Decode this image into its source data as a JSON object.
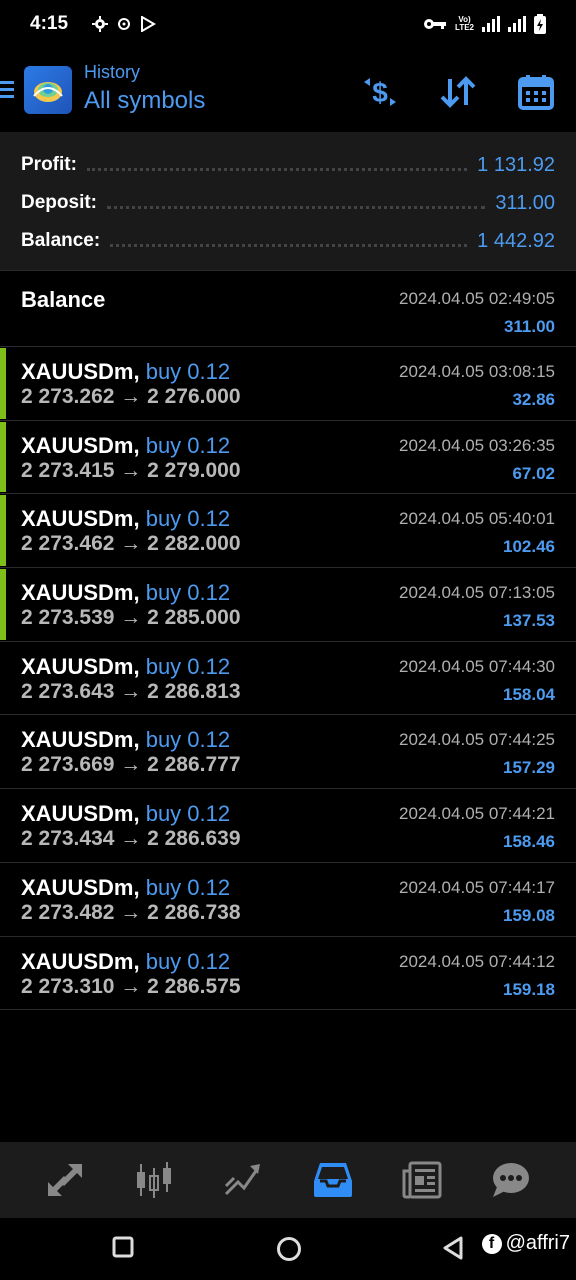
{
  "status_bar": {
    "time": "4:15",
    "volte_top": "Vo)",
    "volte_bottom": "LTE2"
  },
  "header": {
    "subtitle": "History",
    "title": "All symbols",
    "icons": [
      "menu-icon",
      "app-logo",
      "dollar-exchange-icon",
      "sort-icon",
      "calendar-icon"
    ]
  },
  "summary": {
    "profit_label": "Profit:",
    "profit_value": "1 131.92",
    "deposit_label": "Deposit:",
    "deposit_value": "311.00",
    "balance_label": "Balance:",
    "balance_value": "1 442.92"
  },
  "balance_entry": {
    "label": "Balance",
    "time": "2024.04.05 02:49:05",
    "amount": "311.00"
  },
  "deals": [
    {
      "symbol": "XAUUSDm,",
      "type": "buy 0.12",
      "prices": "2 273.262 → 2 276.000",
      "time": "2024.04.05 03:08:15",
      "profit": "32.86",
      "marked": true
    },
    {
      "symbol": "XAUUSDm,",
      "type": "buy 0.12",
      "prices": "2 273.415 → 2 279.000",
      "time": "2024.04.05 03:26:35",
      "profit": "67.02",
      "marked": true
    },
    {
      "symbol": "XAUUSDm,",
      "type": "buy 0.12",
      "prices": "2 273.462 → 2 282.000",
      "time": "2024.04.05 05:40:01",
      "profit": "102.46",
      "marked": true
    },
    {
      "symbol": "XAUUSDm,",
      "type": "buy 0.12",
      "prices": "2 273.539 → 2 285.000",
      "time": "2024.04.05 07:13:05",
      "profit": "137.53",
      "marked": true
    },
    {
      "symbol": "XAUUSDm,",
      "type": "buy 0.12",
      "prices": "2 273.643 → 2 286.813",
      "time": "2024.04.05 07:44:30",
      "profit": "158.04",
      "marked": false
    },
    {
      "symbol": "XAUUSDm,",
      "type": "buy 0.12",
      "prices": "2 273.669 → 2 286.777",
      "time": "2024.04.05 07:44:25",
      "profit": "157.29",
      "marked": false
    },
    {
      "symbol": "XAUUSDm,",
      "type": "buy 0.12",
      "prices": "2 273.434 → 2 286.639",
      "time": "2024.04.05 07:44:21",
      "profit": "158.46",
      "marked": false
    },
    {
      "symbol": "XAUUSDm,",
      "type": "buy 0.12",
      "prices": "2 273.482 → 2 286.738",
      "time": "2024.04.05 07:44:17",
      "profit": "159.08",
      "marked": false
    },
    {
      "symbol": "XAUUSDm,",
      "type": "buy 0.12",
      "prices": "2 273.310 → 2 286.575",
      "time": "2024.04.05 07:44:12",
      "profit": "159.18",
      "marked": false
    }
  ],
  "bottom_nav": {
    "items": [
      "quotes-icon",
      "chart-icon",
      "trade-icon",
      "history-icon",
      "news-icon",
      "chat-icon"
    ],
    "active": "history-icon"
  },
  "watermark": {
    "text": "@affri7"
  },
  "colors": {
    "accent": "#4d9bf0",
    "marker": "#7fbf1a",
    "background": "#000000",
    "summary_bg": "#1a1a1a"
  }
}
